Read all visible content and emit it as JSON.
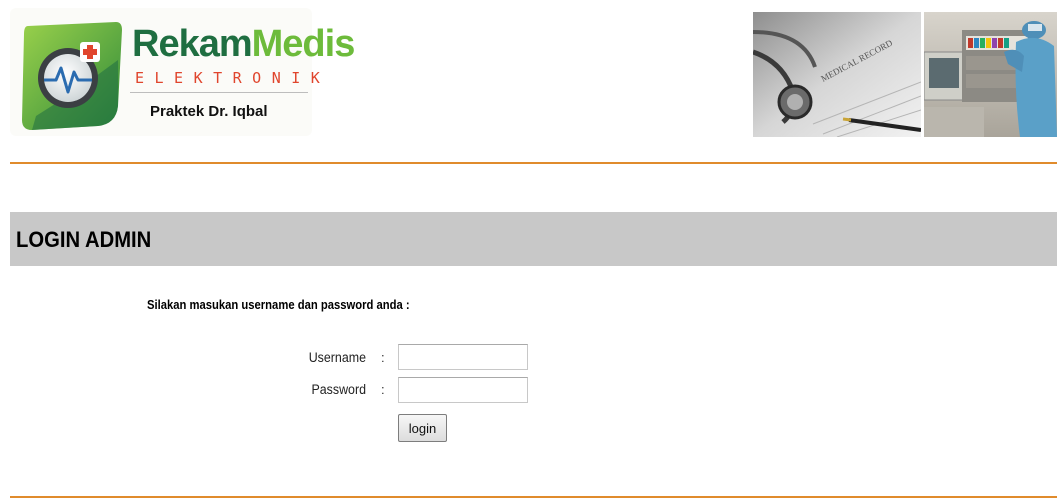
{
  "header": {
    "logo": {
      "word_part1": "Rekam",
      "word_part2": "Medis",
      "tagline": "ELEKTRONIK",
      "subtitle": "Praktek Dr. Iqbal"
    },
    "photos": [
      {
        "icon": "medical-record-stethoscope-photo",
        "caption": "MEDICAL RECORD"
      },
      {
        "icon": "doctor-filing-cabinet-photo"
      }
    ]
  },
  "title_bar": {
    "title": "LOGIN ADMIN"
  },
  "form": {
    "instruction": "Silakan masukan username dan password anda :",
    "username_label": "Username",
    "password_label": "Password",
    "separator": ":",
    "username_value": "",
    "password_value": "",
    "button_label": "login"
  },
  "colors": {
    "divider": "#e08b2c",
    "title_bar_bg": "#c8c8c8",
    "logo_dark_green": "#1f6e41",
    "logo_light_green": "#6dbb3b",
    "logo_red": "#e0452d"
  }
}
